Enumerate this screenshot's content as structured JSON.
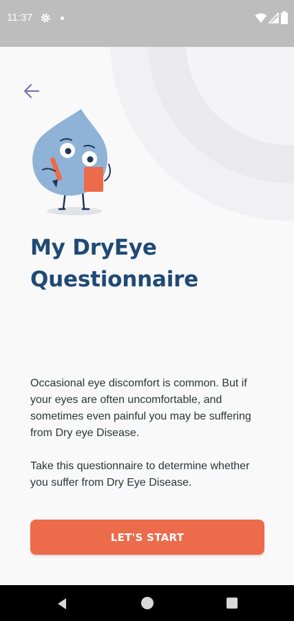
{
  "status_bar": {
    "time": "11:37",
    "icons": [
      "settings-gear-icon",
      "notification-dot-icon",
      "wifi-icon",
      "cell-signal-icon",
      "battery-icon"
    ]
  },
  "header": {
    "back_icon": "arrow-left-icon"
  },
  "hero": {
    "mascot": "water-drop-mascot-with-clipboard",
    "title_line1": "My DryEye",
    "title_line2": "Questionnaire"
  },
  "body": {
    "paragraph_1": "Occasional eye discomfort is common. But if your eyes are often uncomfortable, and sometimes even painful you may be suffering from Dry eye Disease.",
    "paragraph_2": "Take this questionnaire to determine whether you suffer from Dry Eye Disease."
  },
  "cta": {
    "start_label": "LET'S START"
  },
  "nav_bar": {
    "icons": [
      "nav-back-icon",
      "nav-home-icon",
      "nav-recents-icon"
    ]
  },
  "colors": {
    "title": "#1f4a74",
    "button": "#ec6b4b",
    "back_arrow": "#7b73a8",
    "mascot_body": "#8fb3d6",
    "clipboard": "#ec6b4b"
  }
}
